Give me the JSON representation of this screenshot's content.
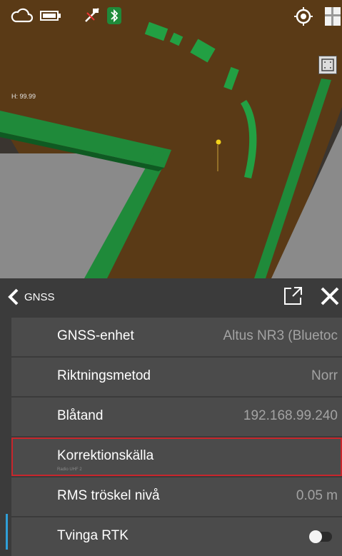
{
  "map": {
    "height_label": "H: 99.99"
  },
  "status_icons": [
    "cloud-icon",
    "battery-icon",
    "satellite-off-icon",
    "bluetooth-icon",
    "gps-target-icon",
    "layers-icon"
  ],
  "panel": {
    "title": "GNSS",
    "rows": [
      {
        "label": "GNSS-enhet",
        "value": "Altus NR3 (Bluetoc"
      },
      {
        "label": "Riktningsmetod",
        "value": "Norr"
      },
      {
        "label": "Blåtand",
        "value": "192.168.99.240"
      },
      {
        "label": "Korrektionskälla",
        "value": "",
        "sub": "Radio UHF 2"
      },
      {
        "label": "RMS tröskel nivå",
        "value": "0.05 m"
      },
      {
        "label": "Tvinga RTK",
        "toggle": false
      }
    ]
  },
  "colors": {
    "ground": "#5a3a16",
    "wall": "#1f8a3a",
    "panel_bg": "#3b3b3b",
    "row_bg": "#4b4b4b",
    "selection": "#c8262c",
    "accent": "#2f9fd8"
  }
}
